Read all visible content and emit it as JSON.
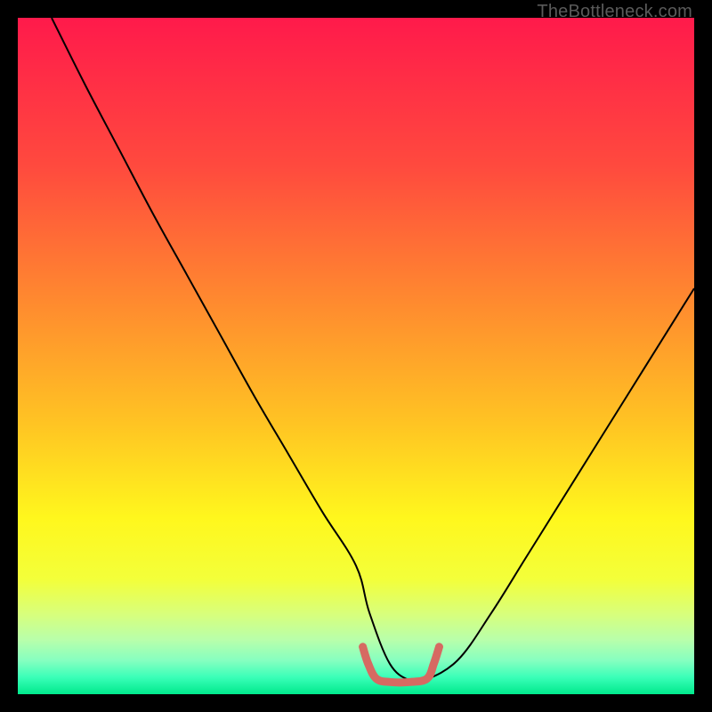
{
  "watermark": "TheBottleneck.com",
  "chart_data": {
    "type": "line",
    "title": "",
    "xlabel": "",
    "ylabel": "",
    "xlim": [
      0,
      100
    ],
    "ylim": [
      0,
      100
    ],
    "grid": false,
    "legend": false,
    "background": {
      "type": "vertical-gradient",
      "stops": [
        {
          "offset": 0.0,
          "color": "#ff1a4b"
        },
        {
          "offset": 0.22,
          "color": "#ff4a3e"
        },
        {
          "offset": 0.42,
          "color": "#ff8a2f"
        },
        {
          "offset": 0.6,
          "color": "#ffc423"
        },
        {
          "offset": 0.74,
          "color": "#fff71d"
        },
        {
          "offset": 0.83,
          "color": "#f3ff3a"
        },
        {
          "offset": 0.88,
          "color": "#d9ff7a"
        },
        {
          "offset": 0.92,
          "color": "#b8ffab"
        },
        {
          "offset": 0.95,
          "color": "#86ffc0"
        },
        {
          "offset": 0.975,
          "color": "#3affb8"
        },
        {
          "offset": 1.0,
          "color": "#00e98c"
        }
      ]
    },
    "series": [
      {
        "name": "bottleneck-curve",
        "stroke": "#000000",
        "stroke_width": 2,
        "x": [
          5,
          10,
          15,
          20,
          25,
          30,
          35,
          40,
          45,
          50,
          52,
          55,
          58,
          60,
          65,
          70,
          75,
          80,
          85,
          90,
          95,
          100
        ],
        "y": [
          100,
          90,
          80.5,
          71,
          62,
          53,
          44,
          35.5,
          27,
          19,
          12,
          4.5,
          2,
          2,
          5,
          12,
          20,
          28,
          36,
          44,
          52,
          60
        ]
      },
      {
        "name": "flat-bottom-highlight",
        "stroke": "#d66a62",
        "stroke_width": 9,
        "linecap": "round",
        "x": [
          51.0,
          51.8,
          53.0,
          55.0,
          58.0,
          60.5,
          61.5,
          62.3
        ],
        "y": [
          7.0,
          4.5,
          2.3,
          1.8,
          1.8,
          2.3,
          4.5,
          7.0
        ]
      }
    ]
  }
}
